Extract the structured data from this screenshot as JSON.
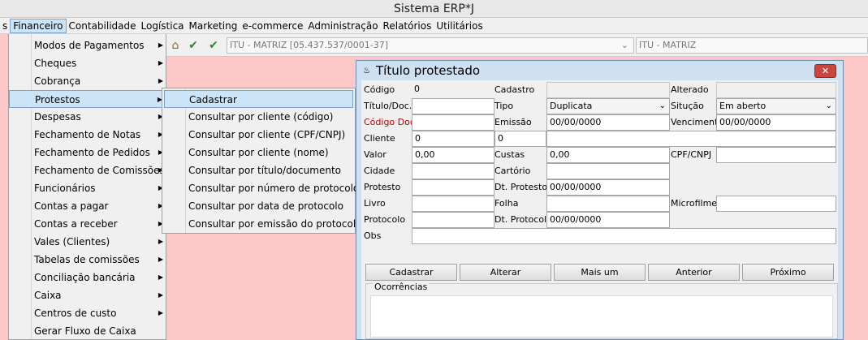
{
  "app": {
    "title": "Sistema ERP*J"
  },
  "menubar": [
    "s",
    "Financeiro",
    "Contabilidade",
    "Logística",
    "Marketing",
    "e-commerce",
    "Administração",
    "Relatórios",
    "Utilitários"
  ],
  "financeiro_menu": [
    {
      "label": "Modos de Pagamentos",
      "submenu": true
    },
    {
      "label": "Cheques",
      "submenu": true
    },
    {
      "label": "Cobrança",
      "submenu": true
    },
    {
      "label": "Protestos",
      "submenu": true
    },
    {
      "label": "Despesas",
      "submenu": true
    },
    {
      "label": "Fechamento de Notas",
      "submenu": true
    },
    {
      "label": "Fechamento de Pedidos",
      "submenu": true
    },
    {
      "label": "Fechamento de Comissões",
      "submenu": true
    },
    {
      "label": "Funcionários",
      "submenu": true
    },
    {
      "label": "Contas a pagar",
      "submenu": true
    },
    {
      "label": "Contas a receber",
      "submenu": true
    },
    {
      "label": "Vales (Clientes)",
      "submenu": true
    },
    {
      "label": "Tabelas de comissões",
      "submenu": true
    },
    {
      "label": "Conciliação bancária",
      "submenu": true
    },
    {
      "label": "Caixa",
      "submenu": true
    },
    {
      "label": "Centros de custo",
      "submenu": true
    },
    {
      "label": "Gerar Fluxo de Caixa",
      "submenu": false
    }
  ],
  "protestos_submenu": [
    "Cadastrar",
    "Consultar por cliente (código)",
    "Consultar por cliente (CPF/CNPJ)",
    "Consultar por cliente (nome)",
    "Consultar por título/documento",
    "Consultar por número de protocolo",
    "Consultar por data de protocolo",
    "Consultar por emissão do protocolo"
  ],
  "toolbar": {
    "company_combo": "ITU - MATRIZ [05.437.537/0001-37]",
    "branch_combo": "ITU - MATRIZ"
  },
  "dialog": {
    "title": "Título protestado",
    "close": "✕",
    "labels": {
      "codigo": "Código",
      "cadastro": "Cadastro",
      "alterado": "Alterado",
      "titulo": "Título/Doc.",
      "tipo": "Tipo",
      "situacao": "Situção",
      "codigo_doc": "Código Doc.",
      "emissao": "Emissão",
      "vencimento": "Vencimento",
      "cliente": "Cliente",
      "valor": "Valor",
      "custas": "Custas",
      "cpf_cnpj": "CPF/CNPJ",
      "cidade": "Cidade",
      "cartorio": "Cartório",
      "protesto": "Protesto",
      "dt_protesto": "Dt. Protesto",
      "livro": "Livro",
      "folha": "Folha",
      "microfilme": "Microfilme",
      "protocolo": "Protocolo",
      "dt_protocolo": "Dt. Protocolo",
      "obs": "Obs"
    },
    "values": {
      "codigo": "0",
      "tipo": "Duplicata",
      "situacao": "Em aberto",
      "emissao": "00/00/0000",
      "vencimento": "00/00/0000",
      "cliente_code": "0",
      "cliente_code2": "0",
      "valor": "0,00",
      "custas": "0,00",
      "dt_protesto": "00/00/0000",
      "dt_protocolo": "00/00/0000"
    },
    "buttons": [
      "Cadastrar",
      "Alterar",
      "Mais um",
      "Anterior",
      "Próximo"
    ],
    "ocorrencias": "Ocorrências"
  }
}
